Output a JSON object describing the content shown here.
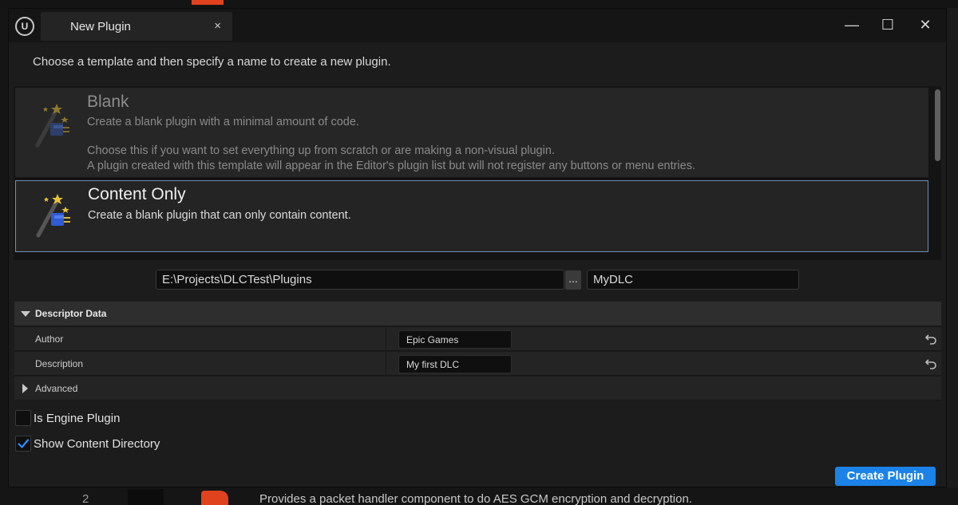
{
  "window": {
    "tab_title": "New Plugin",
    "tab_close": "×",
    "minimize": "—",
    "maximize": "☐",
    "close": "✕"
  },
  "instruction": "Choose a template and then specify a name to create a new plugin.",
  "templates": [
    {
      "title": "Blank",
      "description": "Create a blank plugin with a minimal amount of code.",
      "details_line1": "Choose this if you want to set everything up from scratch or are making a non-visual plugin.",
      "details_line2": "A plugin created with this template will appear in the Editor's plugin list but will not register any buttons or menu entries.",
      "icon": "magic-wand-icon",
      "selected": false
    },
    {
      "title": "Content Only",
      "description": "Create a blank plugin that can only contain content.",
      "icon": "magic-wand-icon",
      "selected": true
    }
  ],
  "plugin_path": "E:\\Projects\\DLCTest\\Plugins",
  "browse_label": "...",
  "plugin_name": "MyDLC",
  "descriptor": {
    "header": "Descriptor Data",
    "author_label": "Author",
    "author_value": "Epic Games",
    "description_label": "Description",
    "description_value": "My first DLC",
    "advanced_label": "Advanced"
  },
  "options": {
    "engine_plugin_label": "Is Engine Plugin",
    "engine_plugin_checked": false,
    "show_content_label": "Show Content Directory",
    "show_content_checked": true
  },
  "create_button": "Create Plugin",
  "background": {
    "row_number": "2",
    "row_text": "Provides a packet handler component to do AES GCM encryption and decryption."
  },
  "colors": {
    "accent": "#1b83e8",
    "selection_border": "#6e8fb7",
    "checkmark": "#2f8cff"
  }
}
